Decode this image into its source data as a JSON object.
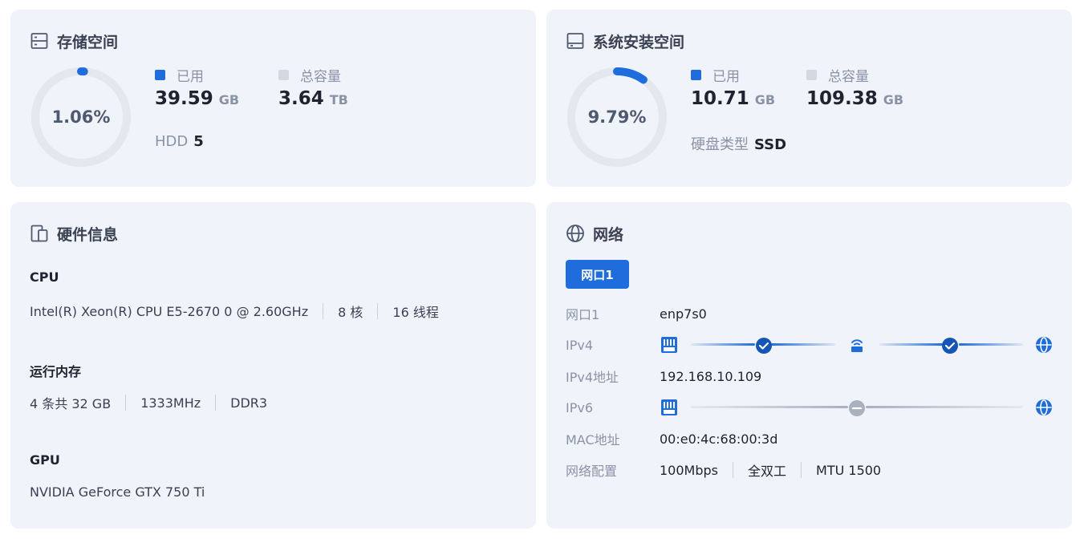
{
  "storage": {
    "title": "存储空间",
    "icon": "storage-icon",
    "percent": "1.06%",
    "percent_value": 1.06,
    "used_label": "已用",
    "used_value": "39.59",
    "used_unit": "GB",
    "total_label": "总容量",
    "total_value": "3.64",
    "total_unit": "TB",
    "disk_label": "HDD",
    "disk_count": "5"
  },
  "system": {
    "title": "系统安装空间",
    "icon": "drive-icon",
    "percent": "9.79%",
    "percent_value": 9.79,
    "used_label": "已用",
    "used_value": "10.71",
    "used_unit": "GB",
    "total_label": "总容量",
    "total_value": "109.38",
    "total_unit": "GB",
    "disk_type_label": "硬盘类型",
    "disk_type_value": "SSD"
  },
  "hardware": {
    "title": "硬件信息",
    "icon": "devices-icon",
    "cpu_heading": "CPU",
    "cpu_model": "Intel(R) Xeon(R) CPU E5-2670 0 @ 2.60GHz",
    "cpu_cores": "8 核",
    "cpu_threads": "16 线程",
    "ram_heading": "运行内存",
    "ram_modules": "4 条共 32 GB",
    "ram_speed": "1333MHz",
    "ram_type": "DDR3",
    "gpu_heading": "GPU",
    "gpu_model": "NVIDIA GeForce GTX 750 Ti"
  },
  "network": {
    "title": "网络",
    "icon": "globe-icon",
    "tab_label": "网口1",
    "rows": {
      "port_label": "网口1",
      "port_value": "enp7s0",
      "ipv4_label": "IPv4",
      "ipv4_addr_label": "IPv4地址",
      "ipv4_addr_value": "192.168.10.109",
      "ipv6_label": "IPv6",
      "mac_label": "MAC地址",
      "mac_value": "00:e0:4c:68:00:3d",
      "config_label": "网络配置",
      "config_speed": "100Mbps",
      "config_duplex": "全双工",
      "config_mtu": "MTU 1500"
    }
  },
  "colors": {
    "accent": "#1f6ddc",
    "card_bg": "#f0f3f9",
    "ring_track": "#e3e7ee",
    "muted_text": "#8a93a6",
    "total_legend": "#d3d8e2",
    "disabled": "#a9b0be"
  }
}
